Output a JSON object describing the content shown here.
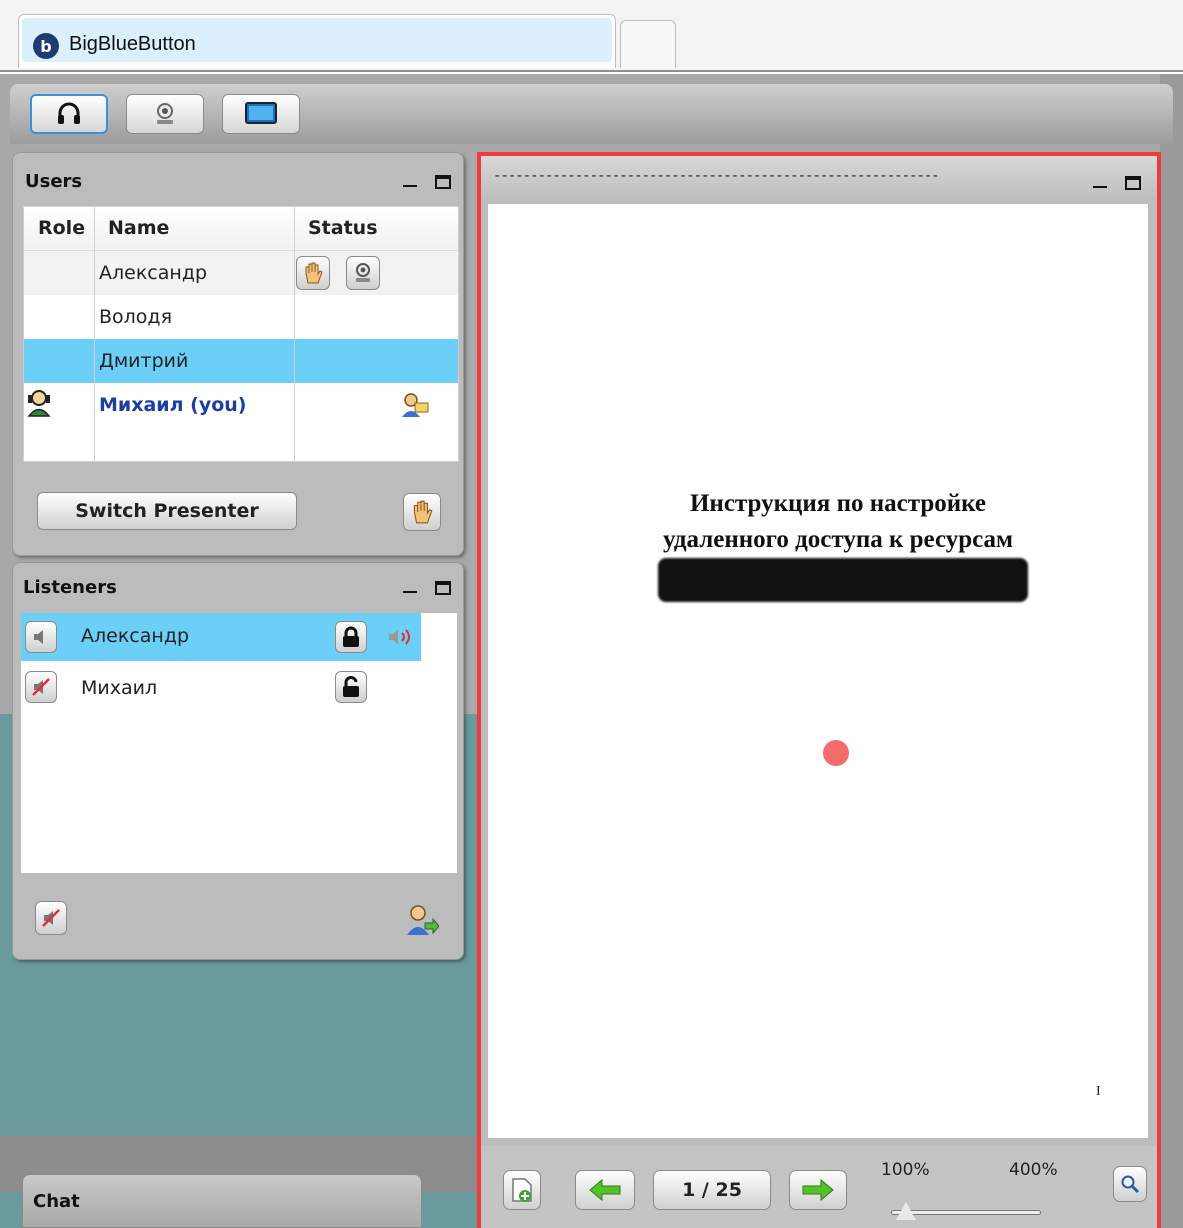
{
  "browser": {
    "tab_title": "BigBlueButton",
    "favicon_letter": "b"
  },
  "toolbar": {
    "buttons": [
      {
        "name": "headset-icon",
        "active": true
      },
      {
        "name": "webcam-icon",
        "active": false
      },
      {
        "name": "desktop-share-icon",
        "active": false
      }
    ]
  },
  "users_panel": {
    "title": "Users",
    "columns": [
      "Role",
      "Name",
      "Status"
    ],
    "rows": [
      {
        "name": "Александр",
        "role_icon": "",
        "status": [
          "raised-hand-icon",
          "webcam-icon"
        ],
        "selected": false
      },
      {
        "name": "Володя",
        "role_icon": "",
        "status": [],
        "selected": false
      },
      {
        "name": "Дмитрий",
        "role_icon": "",
        "status": [],
        "selected": true
      },
      {
        "name": "Михаил (you)",
        "role_icon": "presenter-icon",
        "status": [
          "presenter-status-icon"
        ],
        "selected": false,
        "is_me": true
      }
    ],
    "switch_presenter_label": "Switch Presenter"
  },
  "listeners_panel": {
    "title": "Listeners",
    "rows": [
      {
        "name": "Александр",
        "lock": "locked-icon",
        "talking": true,
        "selected": true
      },
      {
        "name": "Михаил",
        "lock": "unlocked-icon",
        "talking": false,
        "selected": false
      }
    ]
  },
  "chat": {
    "title": "Chat"
  },
  "presentation": {
    "filename": "------------------------------------------------------------",
    "slide_lines": [
      "Инструкция по настройке",
      "удаленного доступа к ресурсам"
    ],
    "page_mark": "I",
    "page_counter": "1 / 25",
    "zoom_min": "100%",
    "zoom_max": "400%",
    "zoom_level": 0.1,
    "accent_border": "#ee3b3b"
  }
}
